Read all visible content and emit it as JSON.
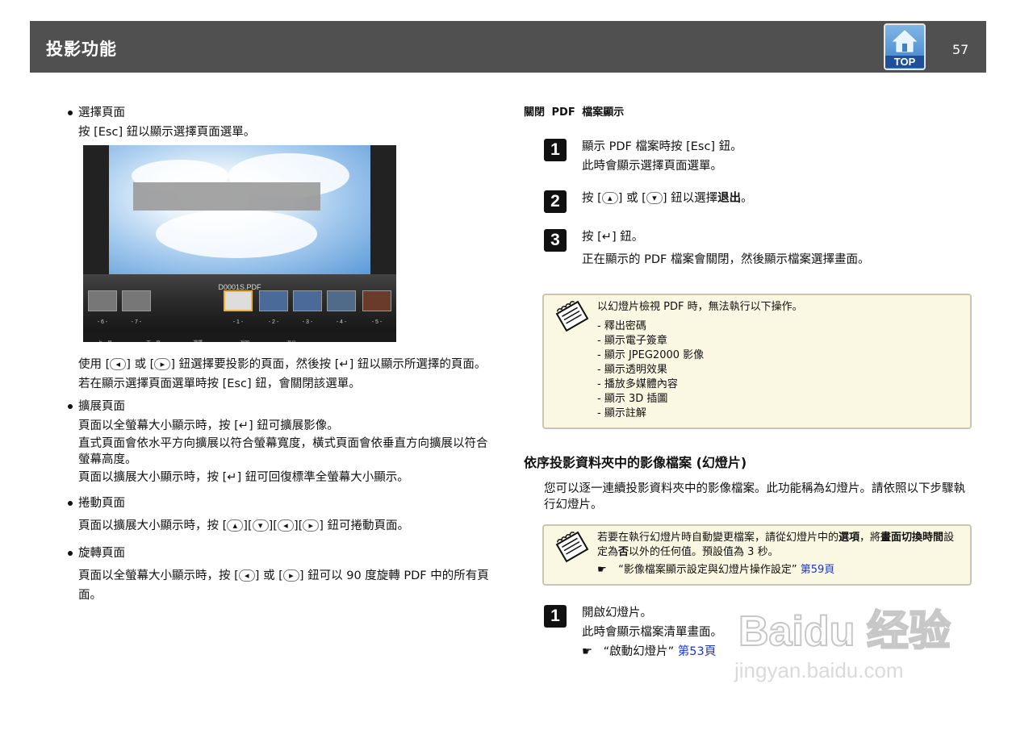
{
  "header": {
    "title": "投影功能",
    "top_label": "TOP",
    "page_number": "57"
  },
  "left": {
    "select_page": {
      "heading": "選擇頁面",
      "instruction_pre": "按 [Esc] 鈕以顯示選擇頁面選單。",
      "screen": {
        "filename": "D0001S.PDF",
        "thumb_numbers": [
          "- 6 -",
          "- 7 -",
          "- 1 -",
          "- 2 -",
          "- 3 -",
          "- 4 -",
          "- 5 -"
        ],
        "nav": [
          "上一頁",
          "下一頁",
          "選擇",
          "返回",
          "退出"
        ]
      },
      "p1_a": "使用",
      "p1_b": "或",
      "p1_c": "鈕選擇要投影的頁面，然後按",
      "p1_d": "鈕以顯示所選擇的頁面。",
      "p2": "若在顯示選擇頁面選單時按 [Esc] 鈕，會關閉該選單。"
    },
    "expand_page": {
      "heading": "擴展頁面",
      "p1_a": "頁面以全螢幕大小顯示時，按",
      "p1_b": "鈕可擴展影像。",
      "p2": "直式頁面會依水平方向擴展以符合螢幕寬度，橫式頁面會依垂直方向擴展以符合螢幕高度。",
      "p3_a": "頁面以擴展大小顯示時，按",
      "p3_b": "鈕可回復標準全螢幕大小顯示。"
    },
    "scroll_page": {
      "heading": "捲動頁面",
      "p1_a": "頁面以擴展大小顯示時，按",
      "p1_b": "鈕可捲動頁面。"
    },
    "rotate_page": {
      "heading": "旋轉頁面",
      "p1_a": "頁面以全螢幕大小顯示時，按",
      "p1_b": "或",
      "p1_c": "鈕可以 90 度旋轉 PDF 中的所有頁面。"
    }
  },
  "right": {
    "close_heading": "關閉 PDF 檔案顯示",
    "steps": [
      {
        "num": "1",
        "line1": "顯示 PDF 檔案時按 [Esc] 鈕。",
        "line2": "此時會顯示選擇頁面選單。"
      },
      {
        "num": "2",
        "a": "按",
        "b": "或",
        "c": "鈕以選擇",
        "bold": "退出",
        "d": "。"
      },
      {
        "num": "3",
        "a": "按",
        "b": "鈕。",
        "line2": "正在顯示的 PDF 檔案會關閉，然後顯示檔案選擇畫面。"
      }
    ],
    "note1": {
      "intro": "以幻燈片檢視 PDF 時，無法執行以下操作。",
      "items": [
        "釋出密碼",
        "顯示電子簽章",
        "顯示 JPEG2000 影像",
        "顯示透明效果",
        "播放多媒體內容",
        "顯示 3D 插圖",
        "顯示註解"
      ]
    },
    "slide_heading": "依序投影資料夾中的影像檔案 (幻燈片)",
    "slide_para": "您可以逐一連續投影資料夾中的影像檔案。此功能稱為幻燈片。請依照以下步驟執行幻燈片。",
    "note2": {
      "t1": "若要在執行幻燈片時自動變更檔案，請從幻燈片中的",
      "b1": "選項",
      "t2": "，將",
      "b2": "畫面切換時間",
      "t3": "設定為",
      "b3": "否",
      "t4": "以外的任何值。預設值為 3 秒。",
      "ref_text": "“影像檔案顯示設定與幻燈片操作設定”",
      "ref_link": "第59頁"
    },
    "step_b1": {
      "num": "1",
      "line1": "開啟幻燈片。",
      "line2": "此時會顯示檔案清單畫面。",
      "ref_text": "“啟動幻燈片”",
      "ref_link": "第53頁"
    }
  },
  "watermark": {
    "brand": "Baidu 经验",
    "url": "jingyan.baidu.com"
  }
}
